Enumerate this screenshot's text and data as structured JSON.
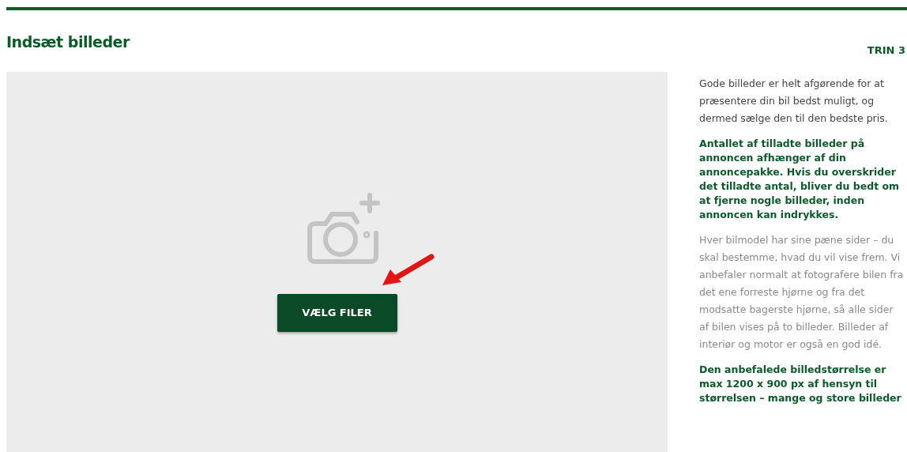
{
  "title": "Indsæt billeder",
  "step": "TRIN 3",
  "upload": {
    "button": "VÆLG FILER"
  },
  "info": [
    {
      "kind": "normal",
      "text": "Gode billeder er helt afgørende for at præsentere din bil bedst muligt, og dermed sælge den til den bedste pris."
    },
    {
      "kind": "emphasis",
      "text": "Antallet af tilladte billeder på annoncen afhænger af din annoncepakke. Hvis du overskrider det tilladte antal, bliver du bedt om at fjerne nogle billeder, inden annoncen kan indrykkes."
    },
    {
      "kind": "muted",
      "text": "Hver bilmodel har sine pæne sider – du skal bestemme, hvad du vil vise frem. Vi anbefaler normalt at fotografere bilen fra det ene forreste hjørne og fra det modsatte bagerste hjørne, så alle sider af bilen vises på to billeder. Billeder af interiør og motor er også en god idé."
    },
    {
      "kind": "emphasis",
      "text": "Den anbefalede billedstørrelse er max 1200 x 900 px af hensyn til størrelsen – mange og store billeder"
    }
  ]
}
